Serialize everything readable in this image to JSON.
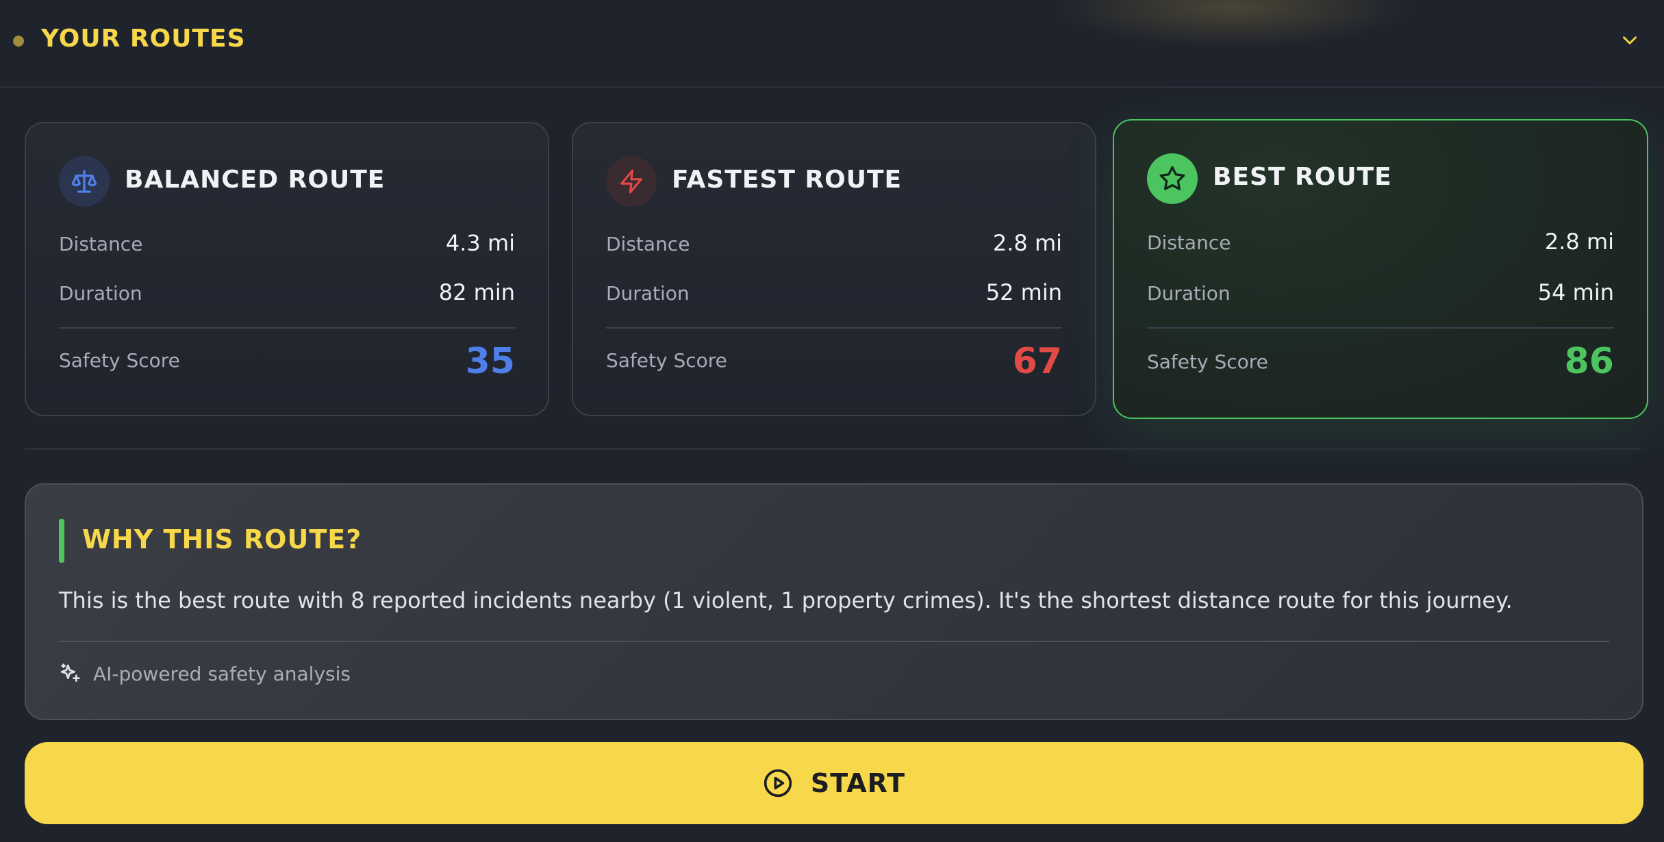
{
  "header": {
    "title": "YOUR ROUTES",
    "toggle_icon": "chevron-down-icon",
    "accent_color": "#f7d84a"
  },
  "routes": [
    {
      "title": "BALANCED ROUTE",
      "icon": "scale-icon",
      "distance_label": "Distance",
      "distance": "4.3 mi",
      "duration_label": "Duration",
      "duration": "82 min",
      "score_label": "Safety Score",
      "score": "35",
      "score_color": "#4f7fe8"
    },
    {
      "title": "FASTEST ROUTE",
      "icon": "lightning-icon",
      "distance_label": "Distance",
      "distance": "2.8 mi",
      "duration_label": "Duration",
      "duration": "52 min",
      "score_label": "Safety Score",
      "score": "67",
      "score_color": "#e24a44"
    },
    {
      "title": "BEST ROUTE",
      "icon": "star-icon",
      "distance_label": "Distance",
      "distance": "2.8 mi",
      "duration_label": "Duration",
      "duration": "54 min",
      "score_label": "Safety Score",
      "score": "86",
      "score_color": "#4cc560"
    }
  ],
  "why": {
    "title": "WHY THIS ROUTE?",
    "text": "This is the best route with 8 reported incidents nearby (1 violent, 1 property crimes). It's the shortest distance route for this journey.",
    "footer_icon": "sparkles-icon",
    "footer_text": "AI-powered safety analysis"
  },
  "start": {
    "label": "START",
    "icon": "play-circle-icon"
  }
}
